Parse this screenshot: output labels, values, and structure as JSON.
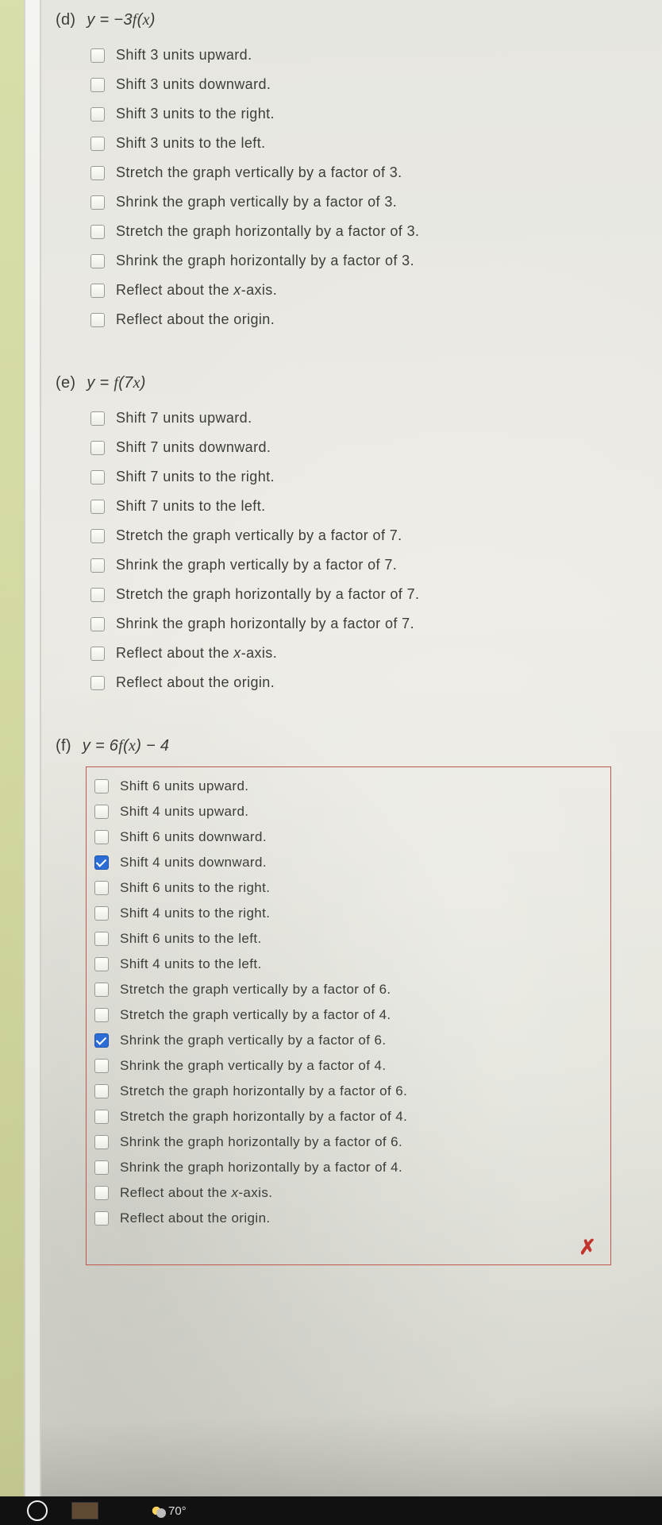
{
  "questions": [
    {
      "label": "(d)",
      "equation_html": "y = −3<span class='fx'>f</span>(<span class='fx'>x</span>)",
      "boxed": false,
      "options": [
        {
          "text": "Shift 3 units upward.",
          "checked": false
        },
        {
          "text": "Shift 3 units downward.",
          "checked": false
        },
        {
          "text": "Shift 3 units to the right.",
          "checked": false
        },
        {
          "text": "Shift 3 units to the left.",
          "checked": false
        },
        {
          "text": "Stretch the graph vertically by a factor of 3.",
          "checked": false
        },
        {
          "text": "Shrink the graph vertically by a factor of 3.",
          "checked": false
        },
        {
          "text": "Stretch the graph horizontally by a factor of 3.",
          "checked": false
        },
        {
          "text": "Shrink the graph horizontally by a factor of 3.",
          "checked": false
        },
        {
          "text_html": "Reflect about the <span class='ital'>x</span>-axis.",
          "checked": false
        },
        {
          "text": "Reflect about the origin.",
          "checked": false
        }
      ]
    },
    {
      "label": "(e)",
      "equation_html": "y = <span class='fx'>f</span>(7<span class='fx'>x</span>)",
      "boxed": false,
      "options": [
        {
          "text": "Shift 7 units upward.",
          "checked": false
        },
        {
          "text": "Shift 7 units downward.",
          "checked": false
        },
        {
          "text": "Shift 7 units to the right.",
          "checked": false
        },
        {
          "text": "Shift 7 units to the left.",
          "checked": false
        },
        {
          "text": "Stretch the graph vertically by a factor of 7.",
          "checked": false
        },
        {
          "text": "Shrink the graph vertically by a factor of 7.",
          "checked": false
        },
        {
          "text": "Stretch the graph horizontally by a factor of 7.",
          "checked": false
        },
        {
          "text": "Shrink the graph horizontally by a factor of 7.",
          "checked": false
        },
        {
          "text_html": "Reflect about the <span class='ital'>x</span>-axis.",
          "checked": false
        },
        {
          "text": "Reflect about the origin.",
          "checked": false
        }
      ]
    },
    {
      "label": "(f)",
      "equation_html": "y = 6<span class='fx'>f</span>(<span class='fx'>x</span>) − 4",
      "boxed": true,
      "close_mark": "✗",
      "options": [
        {
          "text": "Shift 6 units upward.",
          "checked": false
        },
        {
          "text": "Shift 4 units upward.",
          "checked": false
        },
        {
          "text": "Shift 6 units downward.",
          "checked": false
        },
        {
          "text": "Shift 4 units downward.",
          "checked": true
        },
        {
          "text": "Shift 6 units to the right.",
          "checked": false
        },
        {
          "text": "Shift 4 units to the right.",
          "checked": false
        },
        {
          "text": "Shift 6 units to the left.",
          "checked": false
        },
        {
          "text": "Shift 4 units to the left.",
          "checked": false
        },
        {
          "text": "Stretch the graph vertically by a factor of 6.",
          "checked": false
        },
        {
          "text": "Stretch the graph vertically by a factor of 4.",
          "checked": false
        },
        {
          "text": "Shrink the graph vertically by a factor of 6.",
          "checked": true
        },
        {
          "text": "Shrink the graph vertically by a factor of 4.",
          "checked": false
        },
        {
          "text": "Stretch the graph horizontally by a factor of 6.",
          "checked": false
        },
        {
          "text": "Stretch the graph horizontally by a factor of 4.",
          "checked": false
        },
        {
          "text": "Shrink the graph horizontally by a factor of 6.",
          "checked": false
        },
        {
          "text": "Shrink the graph horizontally by a factor of 4.",
          "checked": false
        },
        {
          "text_html": "Reflect about the <span class='ital'>x</span>-axis.",
          "checked": false
        },
        {
          "text": "Reflect about the origin.",
          "checked": false
        }
      ]
    }
  ],
  "taskbar": {
    "temperature": "70°"
  }
}
